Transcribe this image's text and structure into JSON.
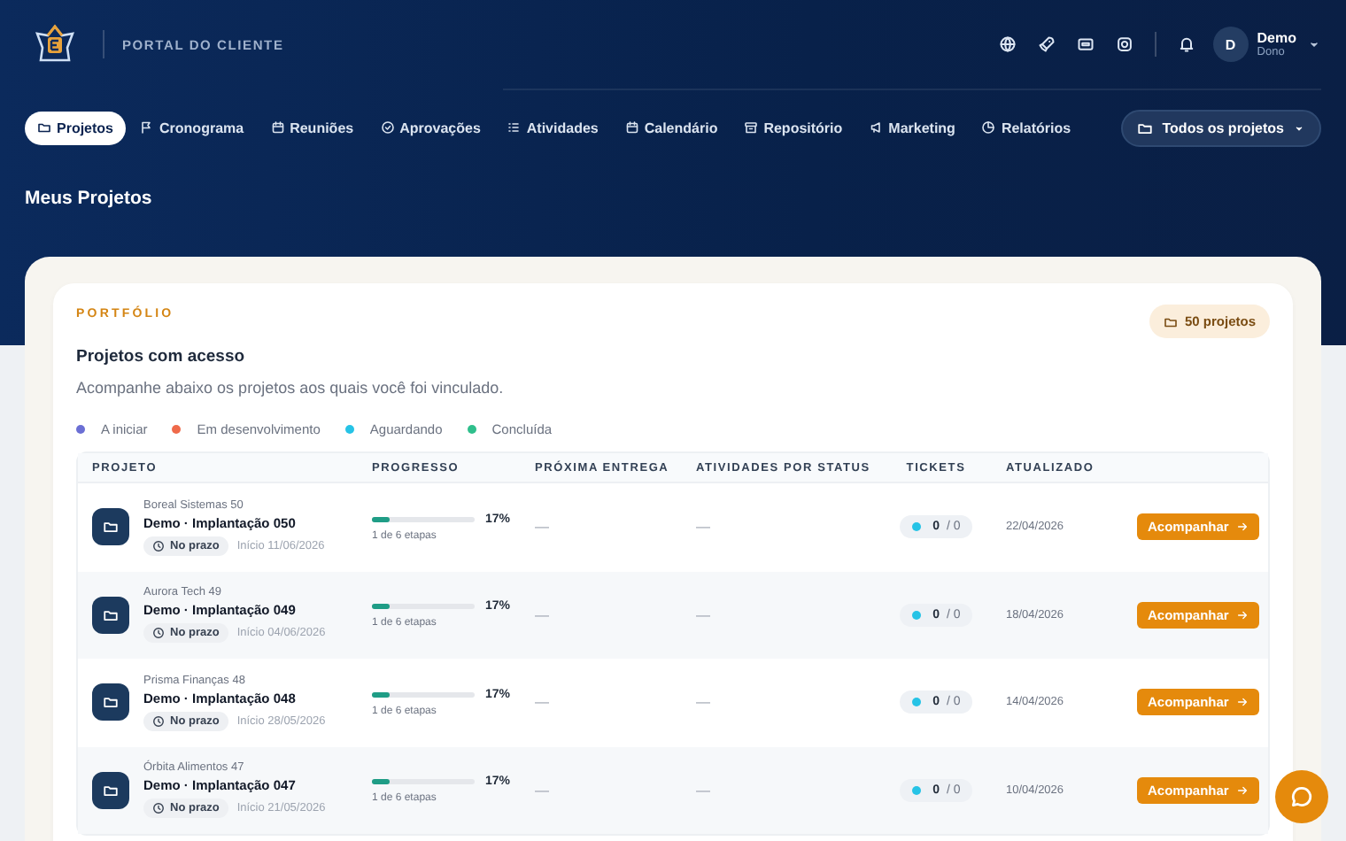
{
  "header": {
    "portal_label": "PORTAL DO CLIENTE",
    "user": {
      "initial": "D",
      "name": "Demo",
      "role": "Dono"
    }
  },
  "nav": {
    "tabs": [
      {
        "label": "Projetos",
        "selected": true
      },
      {
        "label": "Cronograma",
        "selected": false
      },
      {
        "label": "Reuniões",
        "selected": false
      },
      {
        "label": "Aprovações",
        "selected": false
      },
      {
        "label": "Atividades",
        "selected": false
      },
      {
        "label": "Calendário",
        "selected": false
      },
      {
        "label": "Repositório",
        "selected": false
      },
      {
        "label": "Marketing",
        "selected": false
      },
      {
        "label": "Relatórios",
        "selected": false
      }
    ],
    "project_filter": "Todos os projetos"
  },
  "page_title": "Meus Projetos",
  "portfolio": {
    "eyebrow": "PORTFÓLIO",
    "title": "Projetos com acesso",
    "subtitle": "Acompanhe abaixo os projetos aos quais você foi vinculado.",
    "count_badge": "50 projetos",
    "legend": [
      {
        "label": "A iniciar",
        "color": "#6b6fd4"
      },
      {
        "label": "Em desenvolvimento",
        "color": "#ef6a4a"
      },
      {
        "label": "Aguardando",
        "color": "#26c3e6"
      },
      {
        "label": "Concluída",
        "color": "#2fbf8c"
      }
    ],
    "table": {
      "columns": [
        "PROJETO",
        "PROGRESSO",
        "PRÓXIMA ENTREGA",
        "ATIVIDADES POR STATUS",
        "TICKETS",
        "ATUALIZADO"
      ],
      "rows": [
        {
          "client": "Boreal Sistemas 50",
          "name": "Demo · Implantação 050",
          "deadline": "No prazo",
          "start": "Início 11/06/2026",
          "level": 0.17,
          "percent": "17%",
          "steps": "1 de 6 etapas",
          "next_delivery": "—",
          "activities": "—",
          "tickets_open": "0",
          "tickets_total": "/ 0",
          "updated": "22/04/2026",
          "action": "Acompanhar"
        },
        {
          "client": "Aurora Tech 49",
          "name": "Demo · Implantação 049",
          "deadline": "No prazo",
          "start": "Início 04/06/2026",
          "level": 0.17,
          "percent": "17%",
          "steps": "1 de 6 etapas",
          "next_delivery": "—",
          "activities": "—",
          "tickets_open": "0",
          "tickets_total": "/ 0",
          "updated": "18/04/2026",
          "action": "Acompanhar"
        },
        {
          "client": "Prisma Finanças 48",
          "name": "Demo · Implantação 048",
          "deadline": "No prazo",
          "start": "Início 28/05/2026",
          "level": 0.17,
          "percent": "17%",
          "steps": "1 de 6 etapas",
          "next_delivery": "—",
          "activities": "—",
          "tickets_open": "0",
          "tickets_total": "/ 0",
          "updated": "14/04/2026",
          "action": "Acompanhar"
        },
        {
          "client": "Órbita Alimentos 47",
          "name": "Demo · Implantação 047",
          "deadline": "No prazo",
          "start": "Início 21/05/2026",
          "level": 0.17,
          "percent": "17%",
          "steps": "1 de 6 etapas",
          "next_delivery": "—",
          "activities": "—",
          "tickets_open": "0",
          "tickets_total": "/ 0",
          "updated": "10/04/2026",
          "action": "Acompanhar"
        }
      ]
    }
  }
}
